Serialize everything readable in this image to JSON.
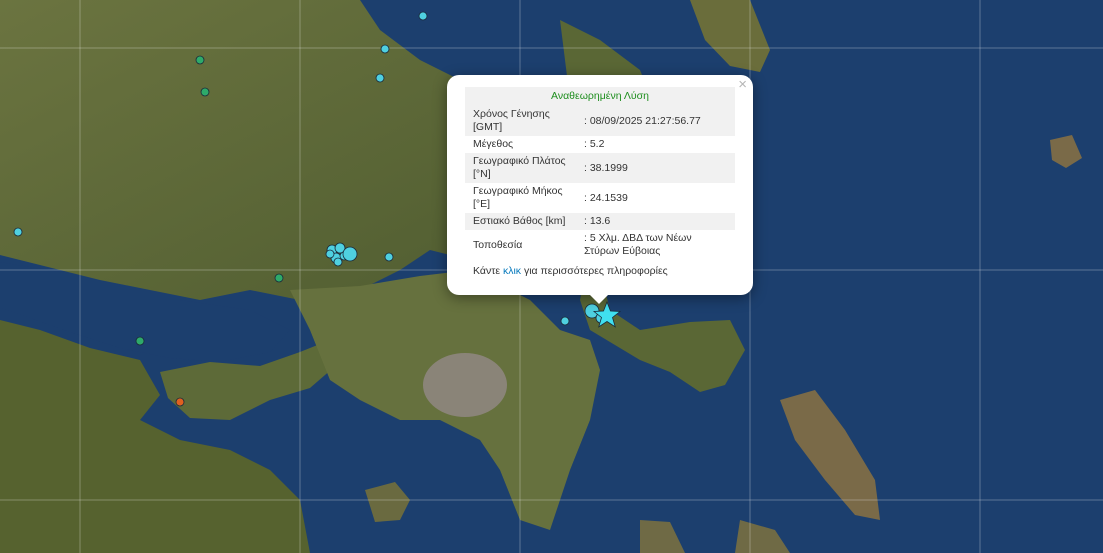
{
  "popup": {
    "title": "Αναθεωρημένη Λύση",
    "close_label": "×",
    "rows": [
      {
        "label": "Χρόνος Γένησης [GMT]",
        "value": ": 08/09/2025 21:27:56.77"
      },
      {
        "label": "Μέγεθος",
        "value": ": 5.2"
      },
      {
        "label": "Γεωγραφικό Πλάτος [°N]",
        "value": ": 38.1999"
      },
      {
        "label": "Γεωγραφικό Μήκος [°E]",
        "value": ": 24.1539"
      },
      {
        "label": "Εστιακό Βάθος [km]",
        "value": ": 13.6"
      },
      {
        "label": "Τοποθεσία",
        "value": ": 5 Χλμ. ΔΒΔ των Νέων Στύρων Εύβοιας"
      }
    ],
    "more_prefix": "Κάντε ",
    "more_link": "κλικ",
    "more_suffix": " για περισσότερες πληροφορίες"
  },
  "colors": {
    "sea": "#1c3f6e",
    "land": "#5e6a3a",
    "event_recent": "#4fd0e0",
    "event_older": "#2eaa6a",
    "event_orange": "#e06020",
    "main_event_star": "#40e0f0"
  },
  "icons": {
    "main_event": "star-icon",
    "close": "close-icon"
  }
}
